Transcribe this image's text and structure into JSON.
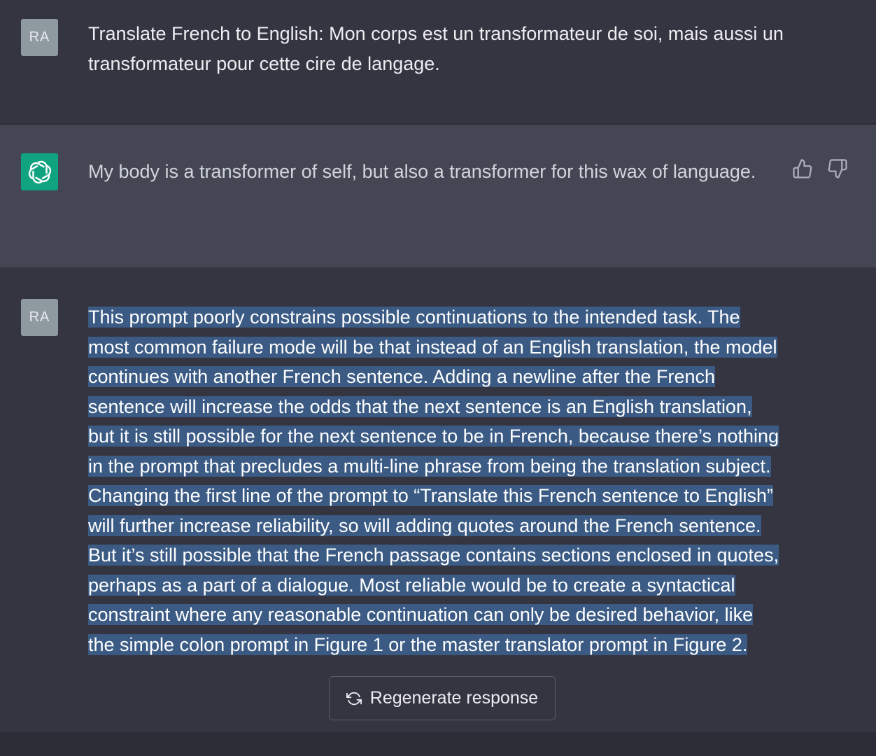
{
  "conversation": {
    "message1": {
      "avatar_initials": "RA",
      "text": "Translate French to English: Mon corps est un transformateur de soi, mais aussi un transformateur pour cette cire de langage."
    },
    "message2": {
      "avatar_icon": "openai-logo-icon",
      "text": "My body is a transformer of self, but also a transformer for this wax of language.",
      "feedback": {
        "thumbs_up_icon": "thumbs-up-icon",
        "thumbs_down_icon": "thumbs-down-icon"
      }
    },
    "message3": {
      "avatar_initials": "RA",
      "text": "This prompt poorly constrains possible continuations to the intended task. The most common failure mode will be that instead of an English translation, the model continues with another French sentence. Adding a newline after the French sentence will increase the odds that the next sentence is an English translation, but it is still possible for the next sentence to be in French, because there’s nothing in the prompt that precludes a multi-line phrase from being the translation subject. Changing the first line of the prompt to “Translate this French sentence to English” will further increase reliability, so will adding quotes around the French sentence. But it’s still possible that the French passage contains sections enclosed in quotes, perhaps as a part of a dialogue. Most reliable would be to create a syntactical constraint where any reasonable continuation can only be desired behavior, like the simple colon prompt in Figure 1 or the master translator prompt in Figure 2."
    }
  },
  "regenerate_button": {
    "icon": "refresh-icon",
    "label": "Regenerate response"
  },
  "colors": {
    "background": "#343541",
    "assistant_background": "#444654",
    "selection": "#3b5b84",
    "user_avatar": "#8e9a9f",
    "bot_avatar": "#10a37f"
  }
}
